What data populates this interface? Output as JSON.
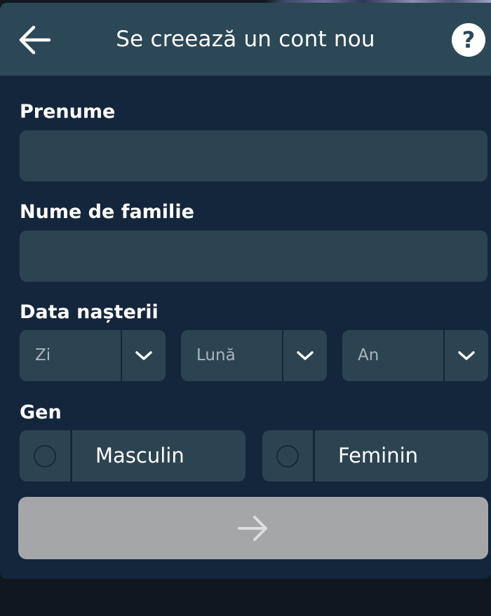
{
  "header": {
    "title": "Se creează un cont nou",
    "back_icon": "arrow-left-icon",
    "help_label": "?"
  },
  "form": {
    "first_name": {
      "label": "Prenume",
      "value": ""
    },
    "last_name": {
      "label": "Nume de familie",
      "value": ""
    },
    "birth_date": {
      "label": "Data nașterii",
      "day": "Zi",
      "month": "Lună",
      "year": "An"
    },
    "gender": {
      "label": "Gen",
      "options": [
        {
          "label": "Masculin",
          "selected": false
        },
        {
          "label": "Feminin",
          "selected": false
        }
      ]
    },
    "submit_icon": "arrow-right-icon"
  },
  "colors": {
    "panel": "#14263b",
    "header": "#2c4755",
    "field": "#2c4452",
    "submit_disabled": "#a4a6a8"
  }
}
